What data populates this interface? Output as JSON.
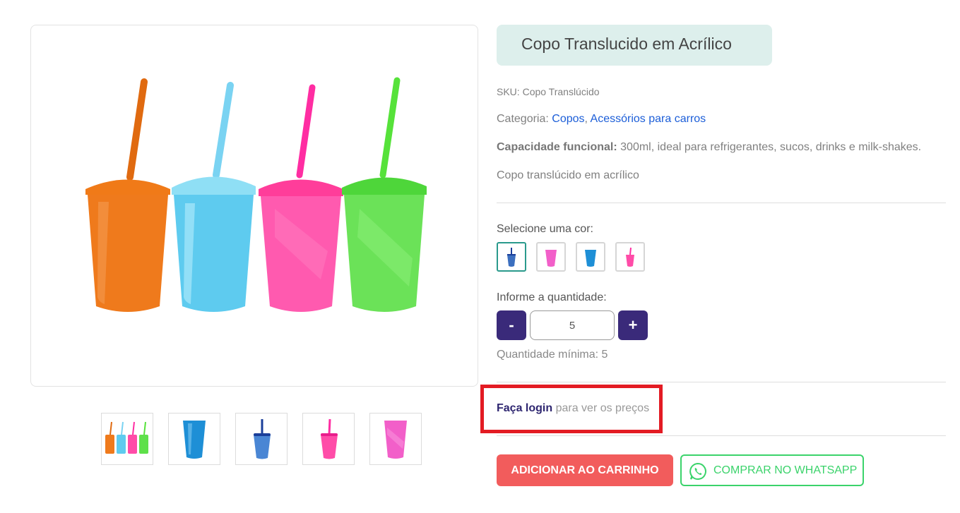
{
  "product": {
    "title": "Copo Translucido em Acrílico",
    "sku_label": "SKU:",
    "sku_value": "Copo Translúcido",
    "category_label": "Categoria:",
    "categories": [
      "Copos",
      "Acessórios para carros"
    ],
    "category_sep": ",",
    "capacity_label": "Capacidade funcional:",
    "capacity_value": "300ml, ideal para refrigerantes, sucos, drinks e milk-shakes.",
    "description": "Copo translúcido em acrílico"
  },
  "gallery": {
    "main_image": "four-translucent-cups-orange-blue-pink-green",
    "thumbnails": [
      "four-cups-thumb",
      "blue-cup-thumb",
      "navy-cup-straw-thumb",
      "pink-cup-straw-thumb",
      "pink-cup-thumb"
    ]
  },
  "color_select": {
    "label": "Selecione uma cor:",
    "options": [
      "navy-straw-cup",
      "pink-cup",
      "blue-cup",
      "pink-straw-cup"
    ],
    "selected_index": 0
  },
  "quantity": {
    "label": "Informe a quantidade:",
    "decrement": "-",
    "increment": "+",
    "value": "5",
    "minimum_text": "Quantidade mínima: 5"
  },
  "login_prompt": {
    "link": "Faça login",
    "text": " para ver os preços"
  },
  "actions": {
    "add_to_cart": "ADICIONAR AO CARRINHO",
    "whatsapp": "COMPRAR NO WHATSAPP",
    "whatsapp_icon": "whatsapp-icon"
  },
  "colors": {
    "title_bg": "#ddefec",
    "primary": "#3a2a7a",
    "cart_button": "#f25c5c",
    "whatsapp": "#3bd36b",
    "highlight": "#e31b23",
    "link": "#1c5ed8"
  }
}
